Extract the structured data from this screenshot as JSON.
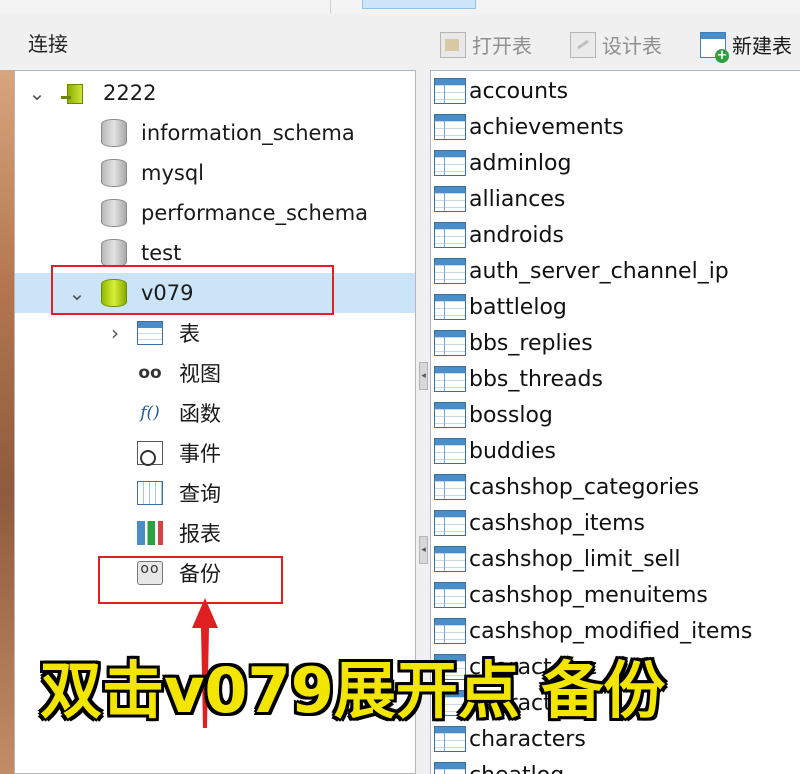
{
  "connections_title": "连接",
  "toolbar": {
    "open_table": "打开表",
    "design_table": "设计表",
    "new_table": "新建表"
  },
  "tree": {
    "connection": "2222",
    "databases": [
      "information_schema",
      "mysql",
      "performance_schema",
      "test"
    ],
    "selected_db": "v079",
    "children": [
      "表",
      "视图",
      "函数",
      "事件",
      "查询",
      "报表",
      "备份"
    ]
  },
  "tables": [
    "accounts",
    "achievements",
    "adminlog",
    "alliances",
    "androids",
    "auth_server_channel_ip",
    "battlelog",
    "bbs_replies",
    "bbs_threads",
    "bosslog",
    "buddies",
    "cashshop_categories",
    "cashshop_items",
    "cashshop_limit_sell",
    "cashshop_menuitems",
    "cashshop_modified_items",
    "character_c",
    "character_s",
    "characters",
    "cheatlog"
  ],
  "annotation": {
    "caption": "双击v079展开点 备份",
    "highlight_color": "#e02020",
    "caption_color": "#f2e600"
  },
  "icons": {
    "connection": "mysql-connection-icon",
    "database": "database-icon",
    "table": "table-icon",
    "view": "view-icon",
    "function": "function-icon",
    "event": "event-icon",
    "query": "query-icon",
    "report": "report-icon",
    "backup": "backup-icon"
  }
}
